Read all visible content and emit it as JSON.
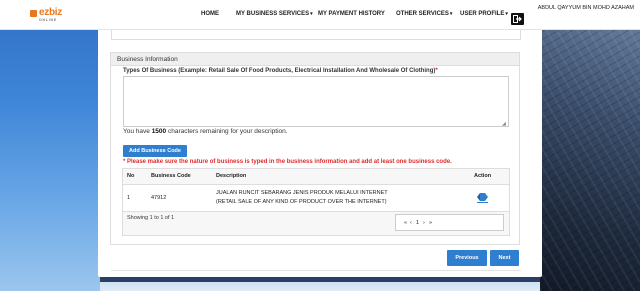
{
  "brand": {
    "logo_text": "ezbiz",
    "logo_sub": "ONLINE"
  },
  "nav": {
    "home": "HOME",
    "my_business_services": "MY BUSINESS SERVICES",
    "my_payment_history": "MY PAYMENT HISTORY",
    "other_services": "OTHER SERVICES",
    "user_profile": "USER PROFILE",
    "user_name": "ABDUL QAYYUM BIN MOHD AZAHAM"
  },
  "business_info": {
    "section_title": "Business Information",
    "types_label": "Types Of Business (Example: Retail Sale Of Food Products, Electrical Installation And Wholesale Of Clothing)",
    "required_mark": "*",
    "types_value": "",
    "remaining_prefix": "You have",
    "remaining_count": "1500",
    "remaining_suffix": "characters remaining for your description.",
    "add_code_label": "Add Business Code",
    "warning": "* Please make sure the nature of business is typed in the business information and add at least one business code."
  },
  "table": {
    "headers": {
      "no": "No",
      "code": "Business Code",
      "description": "Description",
      "action": "Action"
    },
    "rows": [
      {
        "no": "1",
        "code": "47912",
        "desc_line1": "JUALAN RUNCIT SEBARANG JENIS PRODUK MELALUI INTERNET",
        "desc_line2": "(RETAIL SALE OF ANY KIND OF PRODUCT OVER THE INTERNET)"
      }
    ],
    "showing": "Showing 1 to 1 of 1",
    "pager": {
      "first": "«",
      "prev": "‹",
      "page": "1",
      "next": "›",
      "last": "»"
    }
  },
  "footer_buttons": {
    "previous": "Previous",
    "next": "Next"
  },
  "colors": {
    "primary": "#2f7fd0",
    "warning": "#e02b2b",
    "brand": "#e8771e"
  }
}
